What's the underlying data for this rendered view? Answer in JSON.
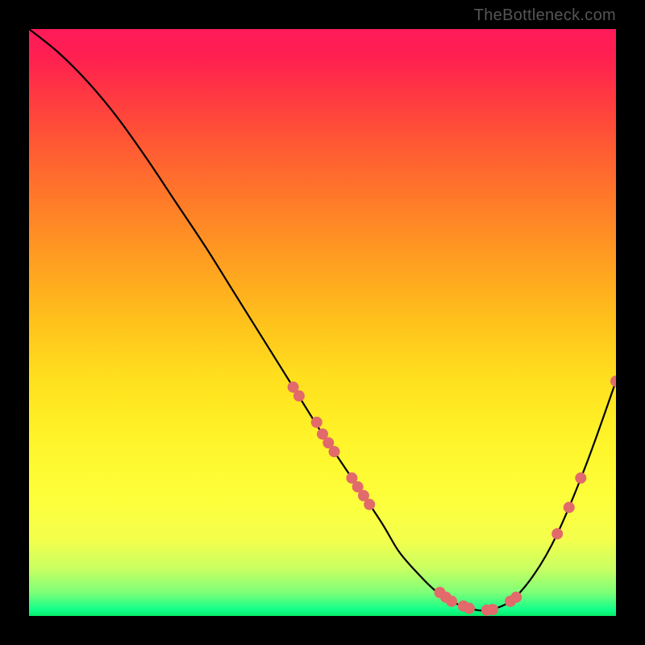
{
  "watermark": "TheBottleneck.com",
  "chart_data": {
    "type": "line",
    "title": "",
    "xlabel": "",
    "ylabel": "",
    "x_range": [
      0,
      100
    ],
    "y_range": [
      0,
      100
    ],
    "background": {
      "style": "vertical-gradient",
      "stops": [
        {
          "pos": 0,
          "color": "#ff1a5a"
        },
        {
          "pos": 50,
          "color": "#ffc21c"
        },
        {
          "pos": 88,
          "color": "#fdff3a"
        },
        {
          "pos": 100,
          "color": "#07eb67"
        }
      ]
    },
    "series": [
      {
        "name": "bottleneck-curve",
        "color": "#000000",
        "x": [
          0,
          5,
          10,
          15,
          20,
          25,
          30,
          35,
          40,
          45,
          50,
          55,
          60,
          63,
          66,
          69,
          72,
          75,
          78,
          82,
          86,
          90,
          95,
          100
        ],
        "y": [
          100,
          96,
          91,
          85,
          78,
          70.5,
          63,
          55,
          47,
          39,
          31,
          23.5,
          16,
          11,
          7.5,
          4.5,
          2.5,
          1.3,
          1,
          2.5,
          7,
          14,
          26,
          40
        ]
      }
    ],
    "markers": {
      "name": "data-points",
      "color": "#e26a6a",
      "radius": 7,
      "points": [
        {
          "x": 45,
          "y": 39
        },
        {
          "x": 46,
          "y": 37.5
        },
        {
          "x": 49,
          "y": 33
        },
        {
          "x": 50,
          "y": 31
        },
        {
          "x": 51,
          "y": 29.5
        },
        {
          "x": 52,
          "y": 28
        },
        {
          "x": 55,
          "y": 23.5
        },
        {
          "x": 56,
          "y": 22
        },
        {
          "x": 57,
          "y": 20.5
        },
        {
          "x": 58,
          "y": 19
        },
        {
          "x": 70,
          "y": 4
        },
        {
          "x": 71,
          "y": 3.2
        },
        {
          "x": 72,
          "y": 2.5
        },
        {
          "x": 74,
          "y": 1.7
        },
        {
          "x": 75,
          "y": 1.3
        },
        {
          "x": 78,
          "y": 1
        },
        {
          "x": 79,
          "y": 1.1
        },
        {
          "x": 82,
          "y": 2.5
        },
        {
          "x": 83,
          "y": 3.2
        },
        {
          "x": 90,
          "y": 14
        },
        {
          "x": 92,
          "y": 18.5
        },
        {
          "x": 94,
          "y": 23.5
        },
        {
          "x": 100,
          "y": 40
        }
      ]
    }
  }
}
